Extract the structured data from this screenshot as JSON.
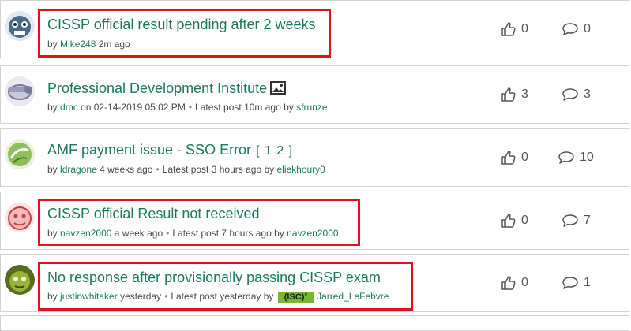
{
  "topics": [
    {
      "title": "CISSP official result pending after 2 weeks",
      "by_label": "by",
      "author": "Mike248",
      "time": "2m ago",
      "kudos": "0",
      "replies": "0"
    },
    {
      "title": "Professional Development Institute",
      "by_label": "by",
      "author": "dmc",
      "time": "on 02-14-2019 05:02 PM",
      "latest_label": "Latest post",
      "latest_time": "10m ago by",
      "latest_author": "sfrunze",
      "kudos": "3",
      "replies": "3"
    },
    {
      "title": "AMF payment issue - SSO Error",
      "pages": [
        "1",
        "2"
      ],
      "by_label": "by",
      "author": "ldragone",
      "time": "4 weeks ago",
      "latest_label": "Latest post",
      "latest_time": "3 hours ago by",
      "latest_author": "eliekhoury0",
      "kudos": "0",
      "replies": "10"
    },
    {
      "title": "CISSP official Result not received",
      "by_label": "by",
      "author": "navzen2000",
      "time": "a week ago",
      "latest_label": "Latest post",
      "latest_time": "7 hours ago by",
      "latest_author": "navzen2000",
      "kudos": "0",
      "replies": "7"
    },
    {
      "title": "No response after provisionally passing CISSP exam",
      "by_label": "by",
      "author": "justinwhitaker",
      "time": "yesterday",
      "latest_label": "Latest post",
      "latest_time": "yesterday by",
      "latest_badge": "(ISC)²",
      "latest_author": "Jarred_LeFebvre",
      "kudos": "0",
      "replies": "1"
    }
  ],
  "icons": {
    "kudos": "thumbs-up-icon",
    "replies": "speech-bubble-icon",
    "image_attachment": "image-icon"
  },
  "colors": {
    "link": "#1b7a5a",
    "highlight": "#e0121c",
    "badge": "#7ab534"
  }
}
